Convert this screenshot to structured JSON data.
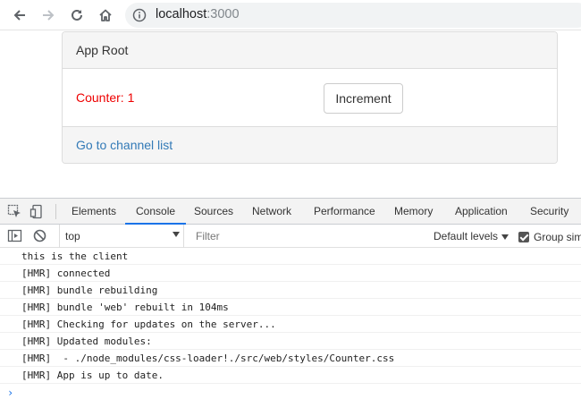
{
  "browser": {
    "url_host": "localhost",
    "url_port": ":3000",
    "icons": [
      "back-arrow-icon",
      "forward-arrow-icon",
      "reload-icon",
      "home-icon",
      "info-icon"
    ]
  },
  "app": {
    "heading": "App Root",
    "counter_text": "Counter: 1",
    "increment_label": "Increment",
    "footer_link": "Go to channel list",
    "colors": {
      "counter": "#ee0000",
      "link": "#337ab7"
    }
  },
  "devtools": {
    "tabs": [
      "Elements",
      "Console",
      "Sources",
      "Network",
      "Performance",
      "Memory",
      "Application",
      "Security"
    ],
    "active_tab": "Console",
    "context": "top",
    "filter_placeholder": "Filter",
    "levels_label": "Default levels",
    "group_label": "Group sim",
    "console_lines": [
      "this is the client",
      "[HMR] connected",
      "[HMR] bundle rebuilding",
      "[HMR] bundle 'web' rebuilt in 104ms",
      "[HMR] Checking for updates on the server...",
      "[HMR] Updated modules:",
      "[HMR]  - ./node_modules/css-loader!./src/web/styles/Counter.css",
      "[HMR] App is up to date."
    ],
    "prompt": "›"
  }
}
